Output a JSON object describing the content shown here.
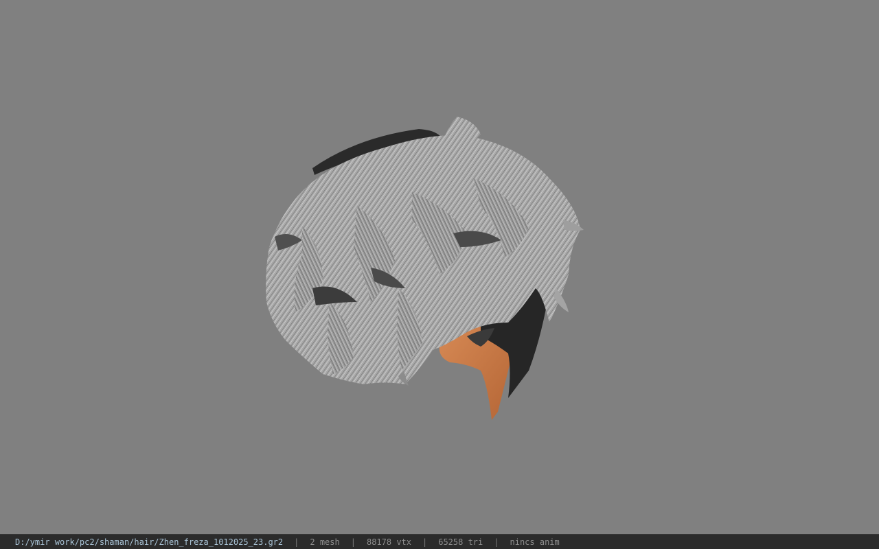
{
  "viewport": {
    "background": "#808080",
    "model": "hair-mesh"
  },
  "status": {
    "path": "D:/ymir work/pc2/shaman/hair/Zhen_freza_1012025_23.gr2",
    "mesh": "2 mesh",
    "vtx": "88178 vtx",
    "tri": "65258 tri",
    "anim": "nincs anim",
    "separator": "|"
  },
  "colors": {
    "statusbar": "#2b2b2b",
    "path_text": "#a9c3d6",
    "hair_light": "#b8b8b8",
    "hair_dark": "#2a2a2a",
    "skin": "#c97a45"
  }
}
